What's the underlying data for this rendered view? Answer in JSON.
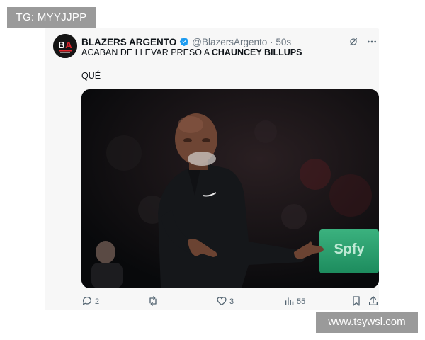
{
  "watermarks": {
    "top": "TG: MYYJJPP",
    "bottom": "www.tsywsl.com"
  },
  "tweet": {
    "author": {
      "display_name": "BLAZERS ARGENTO",
      "handle": "@BlazersArgento",
      "time": "50s",
      "separator": "·",
      "verified": true,
      "avatar_label": "BA"
    },
    "text": {
      "line1_prefix": "ACABAN DE LLEVAR PRESO A ",
      "line1_bold": "CHAUNCEY BILLUPS",
      "line2": "QUÉ"
    },
    "media": {
      "sign_text": "Spfy"
    },
    "actions": {
      "replies": "2",
      "reposts": "",
      "likes": "3",
      "views": "55"
    },
    "icons": {
      "header_left": "grok-icon",
      "header_right": "more-icon",
      "reply": "reply-icon",
      "repost": "repost-icon",
      "like": "heart-icon",
      "views": "views-icon",
      "bookmark": "bookmark-icon",
      "share": "share-icon"
    },
    "colors": {
      "verified": "#1d9bf0",
      "text": "#0f1419",
      "muted": "#536471",
      "avatar_accent": "#e0242b"
    }
  }
}
